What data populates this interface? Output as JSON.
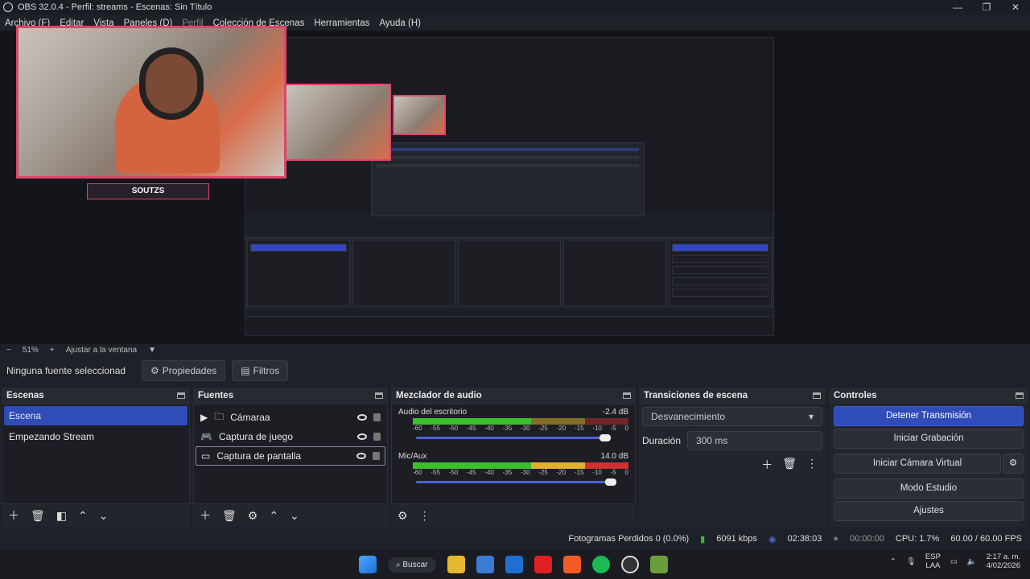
{
  "window": {
    "title": "OBS 32.0.4 - Perfil: streams - Escenas: Sin Título",
    "min": "—",
    "max": "❐",
    "close": "✕"
  },
  "menu": [
    "Archivo (F)",
    "Editar",
    "Vista",
    "Paneles (D)",
    "Perfil",
    "Colección de Escenas",
    "Herramientas",
    "Ayuda (H)"
  ],
  "preview": {
    "name_label": "SOUTZS"
  },
  "zoom": {
    "minus": "−",
    "value": "51%",
    "plus": "+",
    "fit": "Ajustar a la ventana",
    "caret": "▼"
  },
  "source_bar": {
    "none_selected": "Ninguna fuente seleccionad",
    "properties": "Propiedades",
    "filters": "Filtros"
  },
  "scenes": {
    "title": "Escenas",
    "items": [
      "Escena",
      "Empezando Stream"
    ],
    "selected": 0
  },
  "sources": {
    "title": "Fuentes",
    "items": [
      {
        "name": "Cámaraa",
        "icon": "folder-icon"
      },
      {
        "name": "Captura de juego",
        "icon": "gamepad-icon"
      },
      {
        "name": "Captura de pantalla",
        "icon": "monitor-icon"
      }
    ]
  },
  "mixer": {
    "title": "Mezclador de audio",
    "channels": [
      {
        "name": "Audio del escritorio",
        "db": "-2.4 dB",
        "volume": 0.95
      },
      {
        "name": "Mic/Aux",
        "db": "14.0 dB",
        "volume": 1.0
      }
    ],
    "scale": [
      "-60",
      "-55",
      "-50",
      "-45",
      "-40",
      "-35",
      "-30",
      "-25",
      "-20",
      "-15",
      "-10",
      "-5",
      "0"
    ]
  },
  "transitions": {
    "title": "Transiciones de escena",
    "selected": "Desvanecimiento",
    "duration_label": "Duración",
    "duration_value": "300 ms"
  },
  "controls": {
    "title": "Controles",
    "buttons": [
      "Detener Transmisión",
      "Iniciar Grabación",
      "Iniciar Cámara Virtual",
      "Modo Estudio",
      "Ajustes"
    ]
  },
  "status": {
    "dropped": "Fotogramas Perdidos 0 (0.0%)",
    "bitrate": "6091 kbps",
    "stream_time": "02:38:03",
    "rec_time": "00:00:00",
    "cpu": "CPU: 1.7%",
    "fps": "60.00 / 60.00 FPS"
  },
  "taskbar": {
    "search": "Buscar",
    "lang1": "ESP",
    "lang2": "LAA",
    "time": "2:17 a. m.",
    "date": "4/02/2026"
  },
  "colors": {
    "accent": "#2f4cb8",
    "webcam_border": "#e0456a",
    "meter_green": "#3bbf2a",
    "meter_yellow": "#c9a52a",
    "meter_red": "#b02a2a"
  }
}
